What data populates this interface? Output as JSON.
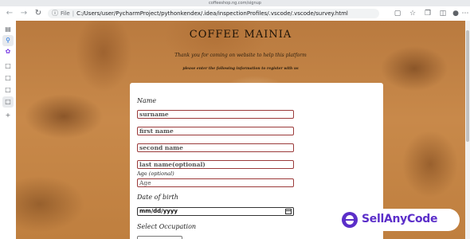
{
  "browser": {
    "tab_url_mini": "coffeeshop.ng.com/signup",
    "address_chip": "File",
    "address_path": "C:/Users/user/PycharmProject/pythonkendex/.idea/inspectionProfiles/.vscode/.vscode/survey.html",
    "icons": [
      "back-arrow-icon",
      "forward-arrow-icon",
      "reload-icon",
      "file-icon",
      "cast-icon",
      "star-icon",
      "extensions-icon",
      "collections-icon",
      "profile-icon",
      "more-icon"
    ]
  },
  "sidebar": {
    "icons": [
      "tab-actions-icon",
      "search-icon",
      "copilot-icon",
      "page-icon",
      "page-icon",
      "page-icon",
      "page-icon",
      "add-icon"
    ]
  },
  "page": {
    "brand": "COFFEE MAINIA",
    "tagline": "Thank you for coming on website to help this platform",
    "instruction": "please enter the following information to register with us",
    "form": {
      "name_label": "Name",
      "surname_placeholder": "surname",
      "firstname_placeholder": "first name",
      "secondname_placeholder": "second name",
      "lastname_placeholder": "last name(optional)",
      "age_label": "Age",
      "age_optional": "(optional)",
      "age_placeholder": "Age",
      "dob_label": "Date of birth",
      "dob_value": "mm/dd/yyyy",
      "occupation_label": "Select Occupation"
    }
  },
  "watermark": {
    "text": "SellAnyCode"
  },
  "colors": {
    "field_border": "#9b3a3a",
    "logo_purple": "#5b2ec9",
    "background_brown": "#c8894a"
  }
}
